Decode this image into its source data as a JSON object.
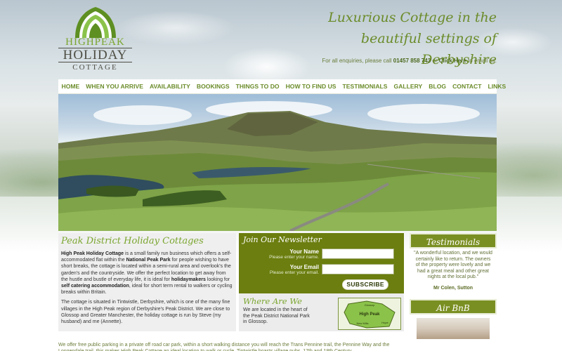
{
  "logo": {
    "line1": "HIGHPEAK",
    "line2": "HOLIDAY",
    "line3": "COTTAGE"
  },
  "header": {
    "tagline_line1": "Luxurious Cottage in the",
    "tagline_line2": "beautiful settings of Derbyshire",
    "enquiry_prefix": "For all enquiries, please call ",
    "phone": "01457 858 743",
    "enquiry_mid": " or ",
    "click_here": "Click Here",
    "enquiry_suffix": " to email us."
  },
  "nav": {
    "items": [
      "HOME",
      "WHEN YOU ARRIVE",
      "AVAILABILITY",
      "BOOKINGS",
      "THINGS TO DO",
      "HOW TO FIND US",
      "TESTIMONIALS",
      "GALLERY",
      "BLOG",
      "CONTACT",
      "LINKS"
    ]
  },
  "intro": {
    "title": "Peak District Holiday Cottages",
    "p1_a": "High Peak Holiday Cottage",
    "p1_b": " is a small family run business which offers a self-accommodated flat within the ",
    "p1_c": "National Peak Park",
    "p1_d": " for people wishing to have short breaks, the cottage is located within a semi-rural area and overlook's the garden's and the countryside. We offer the perfect location to get away from the hustle and bustle of everyday life, it is ideal for ",
    "p1_e": "holidaymakers",
    "p1_f": " looking for ",
    "p1_g": "self catering accommodation",
    "p1_h": ", ideal for short term rental to walkers or cycling breaks within Britain.",
    "p2": "The cottage is situated in Tintwistle, Derbyshire, which is one of the many fine villages in the High Peak region of Derbyshire's Peak District. We are close to Glossop and Greater Manchester, the holiday cottage is run by Steve (my husband) and me (Annette)."
  },
  "newsletter": {
    "title": "Join Our Newsletter",
    "name_label": "Your Name",
    "name_hint": "Please enter your name.",
    "email_label": "Your Email",
    "email_hint": "Please enter your email.",
    "subscribe": "SUBSCRIBE"
  },
  "where": {
    "title": "Where Are We",
    "text": "We are located in the heart of the Peak District National Park in Glossop.",
    "map_labels": [
      "Glossop",
      "High Peak",
      "New Mills",
      "Hope"
    ]
  },
  "testimonials": {
    "title": "Testimonials",
    "quote": "\"A wonderful location, and we would certainly like to return. The owners of the property were lovely and we had a great meal and other great nights at the local pub.\"",
    "author": "Mr Colen, Sutton"
  },
  "airbnb": {
    "title": "Air BnB"
  },
  "footer": {
    "text": "We offer free public parking in a private off road car park, within a short walking distance you will reach the Trans Pennine trail, the Pennine Way and the Longendale trail, this makes High Peak Cottage an ideal location to walk or cycle. Tintwistle boasts village pubs, 17th and 18th Century"
  },
  "colors": {
    "accent": "#6b8c2a",
    "brand_green": "#7aa52e",
    "newsletter_bg": "#6b7e0f"
  }
}
